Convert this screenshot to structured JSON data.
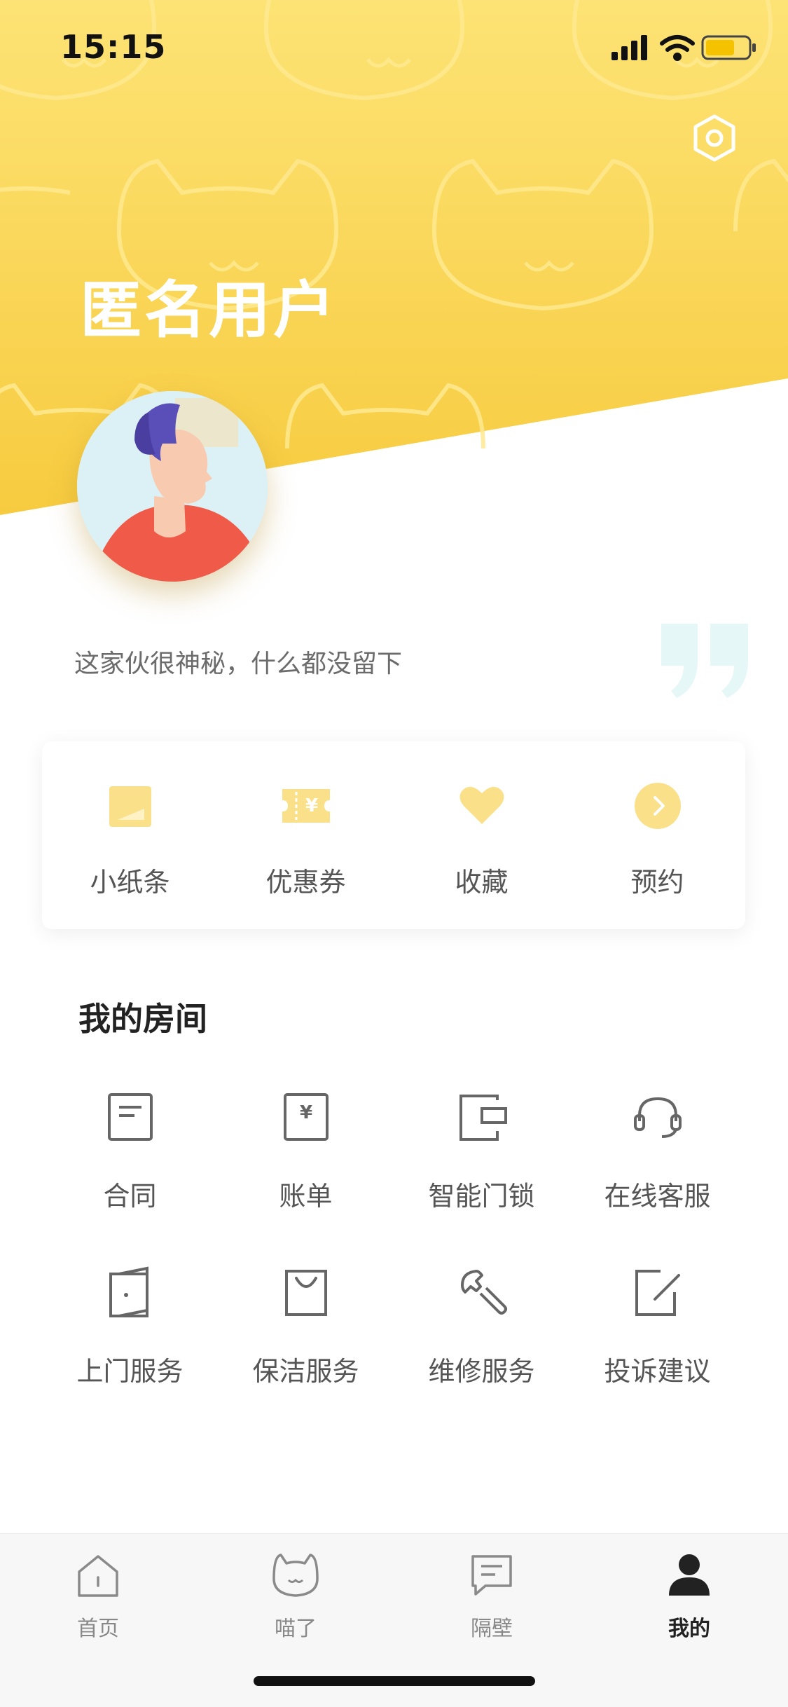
{
  "status_bar": {
    "time": "15:15"
  },
  "colors": {
    "header_yellow_top": "#fde375",
    "header_yellow_bottom": "#f7cb3f",
    "icon_yellow": "#fbe08a",
    "accent_dark": "#222222",
    "inactive_gray": "#888888",
    "quote_mint": "#e6f7f7"
  },
  "profile": {
    "name": "匿名用户",
    "bio": "这家伙很神秘，什么都没留下"
  },
  "quick_actions": [
    {
      "label": "小纸条",
      "icon": "note-icon"
    },
    {
      "label": "优惠券",
      "icon": "coupon-icon"
    },
    {
      "label": "收藏",
      "icon": "heart-icon"
    },
    {
      "label": "预约",
      "icon": "chevron-circle-icon"
    }
  ],
  "my_room": {
    "title": "我的房间",
    "items": [
      {
        "label": "合同",
        "icon": "contract-icon"
      },
      {
        "label": "账单",
        "icon": "bill-icon"
      },
      {
        "label": "智能门锁",
        "icon": "smart-lock-icon"
      },
      {
        "label": "在线客服",
        "icon": "headset-icon"
      },
      {
        "label": "上门服务",
        "icon": "door-icon"
      },
      {
        "label": "保洁服务",
        "icon": "cleaning-bag-icon"
      },
      {
        "label": "维修服务",
        "icon": "wrench-icon"
      },
      {
        "label": "投诉建议",
        "icon": "edit-icon"
      }
    ]
  },
  "tab_bar": {
    "tabs": [
      {
        "label": "首页",
        "icon": "home-icon",
        "active": false
      },
      {
        "label": "喵了",
        "icon": "cat-icon",
        "active": false
      },
      {
        "label": "隔壁",
        "icon": "message-icon",
        "active": false
      },
      {
        "label": "我的",
        "icon": "user-icon",
        "active": true
      }
    ]
  }
}
